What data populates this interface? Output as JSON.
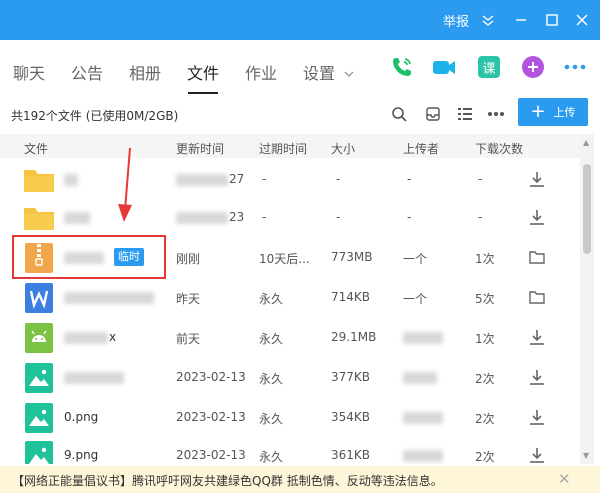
{
  "titlebar": {
    "report_label": "举报",
    "color": "#2b9bf0"
  },
  "nav": {
    "tabs": [
      {
        "label": "聊天"
      },
      {
        "label": "公告"
      },
      {
        "label": "相册"
      },
      {
        "label": "文件",
        "active": true
      },
      {
        "label": "作业"
      },
      {
        "label": "设置"
      }
    ],
    "icons": [
      "phone-icon",
      "video-icon",
      "course-icon",
      "add-app-icon",
      "more-icon"
    ],
    "course_label": "课"
  },
  "toolbar": {
    "summary": "共192个文件 (已使用0M/2GB)",
    "upload_label": "上传",
    "upload_plus": "+"
  },
  "columns": [
    "文件",
    "更新时间",
    "过期时间",
    "大小",
    "上传者",
    "下载次数"
  ],
  "rows": [
    {
      "icon": "folder-icon",
      "name": "",
      "updated": "27",
      "expire": "-",
      "size": "-",
      "uploader": "-",
      "downloads": "-",
      "action": "download-icon"
    },
    {
      "icon": "folder-icon",
      "name": "",
      "updated": "23",
      "expire": "-",
      "size": "-",
      "uploader": "-",
      "downloads": "-",
      "action": "download-icon"
    },
    {
      "icon": "archive-icon",
      "name": "",
      "badge": "临时",
      "updated": "刚刚",
      "expire": "10天后...",
      "size": "773MB",
      "uploader": "一个",
      "downloads": "1次",
      "action": "open-folder-icon"
    },
    {
      "icon": "word-icon",
      "name": "",
      "updated": "昨天",
      "expire": "永久",
      "size": "714KB",
      "uploader": "一个",
      "downloads": "5次",
      "action": "open-folder-icon"
    },
    {
      "icon": "android-icon",
      "name": "x",
      "updated": "前天",
      "expire": "永久",
      "size": "29.1MB",
      "uploader": "",
      "downloads": "1次",
      "action": "download-icon"
    },
    {
      "icon": "image-icon",
      "name": "",
      "updated": "2023-02-13",
      "expire": "永久",
      "size": "377KB",
      "uploader": "",
      "downloads": "2次",
      "action": "download-icon"
    },
    {
      "icon": "image-icon",
      "name": "0.png",
      "updated": "2023-02-13",
      "expire": "永久",
      "size": "354KB",
      "uploader": "",
      "downloads": "2次",
      "action": "download-icon"
    },
    {
      "icon": "image-icon",
      "name": "9.png",
      "updated": "2023-02-13",
      "expire": "永久",
      "size": "361KB",
      "uploader": "",
      "downloads": "2次",
      "action": "download-icon"
    }
  ],
  "notice": {
    "text": "【网络正能量倡议书】腾讯呼吁网友共建绿色QQ群 抵制色情、反动等违法信息。",
    "close": "✕"
  }
}
